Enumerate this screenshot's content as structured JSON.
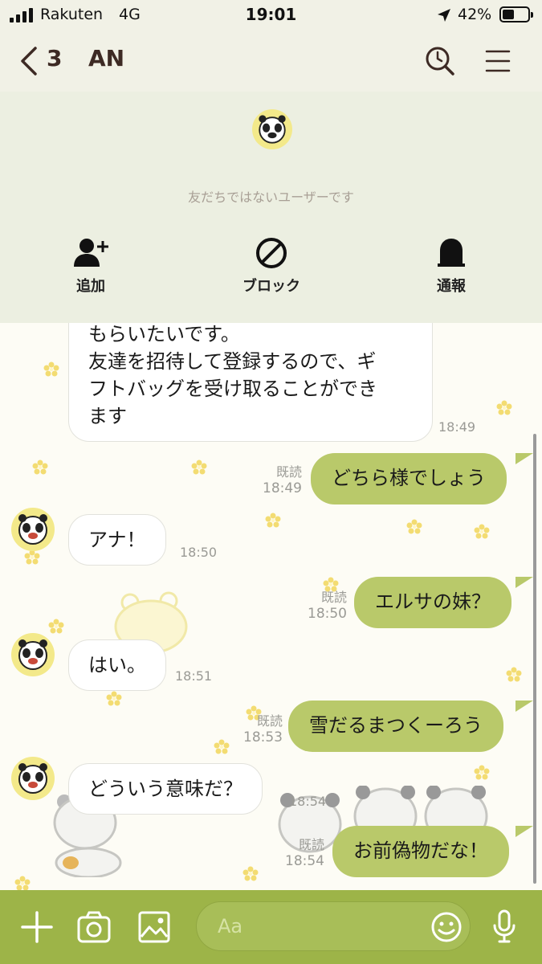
{
  "status_bar": {
    "carrier": "Rakuten",
    "network": "4G",
    "time": "19:01",
    "battery": "42%"
  },
  "header": {
    "back_count": "3",
    "title": "AN"
  },
  "notice": {
    "text": "友だちではないユーザーです",
    "actions": [
      {
        "icon": "add-friend-icon",
        "label": "追加"
      },
      {
        "icon": "block-icon",
        "label": "ブロック"
      },
      {
        "icon": "report-icon",
        "label": "通報"
      }
    ]
  },
  "messages": [
    {
      "side": "in",
      "lines": [
        "もらいたいです。",
        "友達を招待して登録するので、ギ",
        "フトバッグを受け取ることができ",
        "ます"
      ],
      "time": "18:49"
    },
    {
      "side": "out",
      "text": "どちら様でしょう",
      "read": "既読",
      "time": "18:49"
    },
    {
      "side": "in",
      "text": "アナ！",
      "time": "18:50"
    },
    {
      "side": "out",
      "text": "エルサの妹？",
      "read": "既読",
      "time": "18:50"
    },
    {
      "side": "in",
      "text": "はい。",
      "time": "18:51"
    },
    {
      "side": "out",
      "text": "雪だるまつくーろう",
      "read": "既読",
      "time": "18:53"
    },
    {
      "side": "in",
      "text": "どういう意味だ？",
      "time": "18:54"
    },
    {
      "side": "out",
      "text": "お前偽物だな！",
      "read": "既読",
      "time": "18:54"
    }
  ],
  "input": {
    "placeholder": "Aa"
  },
  "colors": {
    "accent": "#9db448",
    "out_bubble": "#b9c96a",
    "panel": "#ecefe1",
    "header": "#f1f1e6"
  }
}
